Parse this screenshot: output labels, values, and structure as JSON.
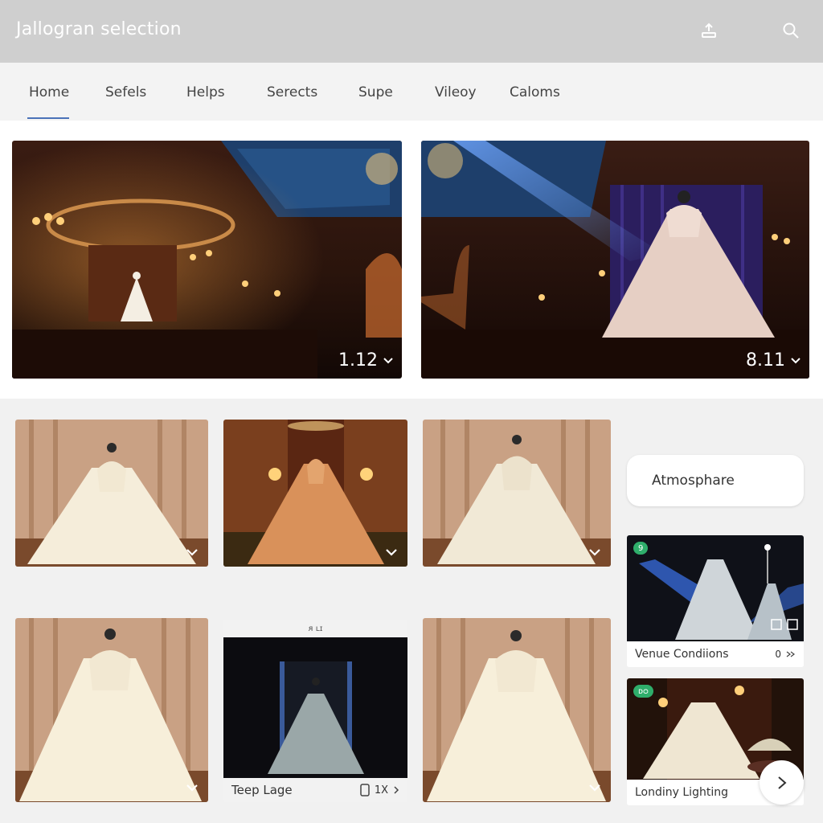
{
  "header": {
    "title": "Jallogran selection",
    "icons": [
      "upload-icon",
      "search-icon"
    ]
  },
  "nav": {
    "items": [
      "Home",
      "Sefels",
      "Helps",
      "Serects",
      "Supe",
      "Vileoy",
      "Caloms"
    ],
    "active": "Home"
  },
  "hero": [
    {
      "value": "1.12",
      "icon": "chevron-down-icon"
    },
    {
      "value": "8.11",
      "icon": "chevron-down-icon"
    }
  ],
  "gallery": {
    "teep_lage": {
      "label": "Teep Lage",
      "strip_text": "ᴙ ʟɪ",
      "meta": "1X"
    }
  },
  "sidebar": {
    "atmosphere_label": "Atmosphare",
    "venue_conditions": {
      "label": "Venue Condiions",
      "meta": "0",
      "badge": "9"
    },
    "london_lighting": {
      "label": "Londiny Lighting",
      "badge": "ᴅᴑ"
    }
  },
  "colors": {
    "header_bg": "#cfcfcf",
    "accent": "#4a72b8",
    "badge": "#2fae6b"
  }
}
